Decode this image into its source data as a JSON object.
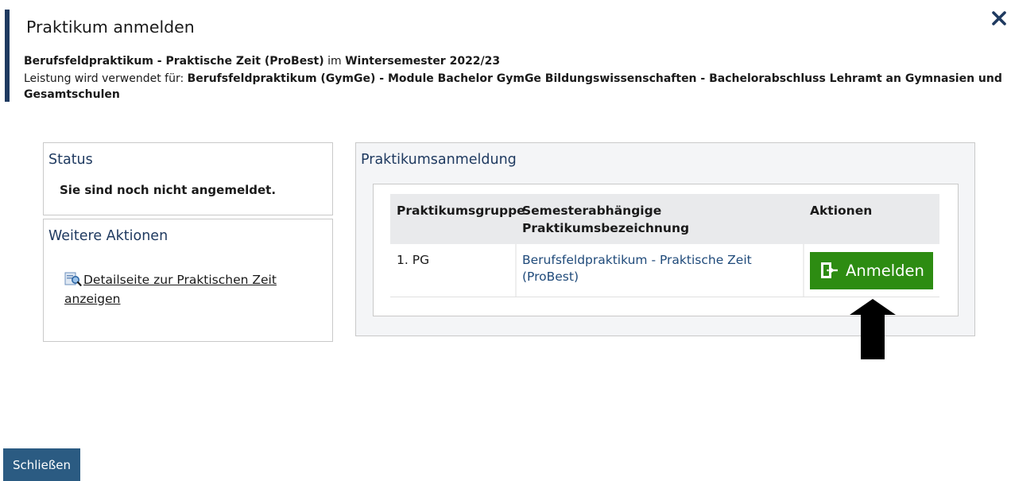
{
  "dialog": {
    "title": "Praktikum anmelden",
    "close_icon": "close-icon",
    "subtitle_bold_1": "Berufsfeldpraktikum - Praktische Zeit (ProBest)",
    "subtitle_text_1": " im ",
    "subtitle_bold_2": "Wintersemester 2022/23",
    "usage_label": "Leistung wird verwendet für: ",
    "usage_value_line1": "Berufsfeldpraktikum (GymGe) - Module Bachelor GymGe Bildungswissenschaften - Bachelorabschluss Lehramt an Gymnasien und",
    "usage_value_line2": "Gesamtschulen"
  },
  "status_panel": {
    "heading": "Status",
    "text": "Sie sind noch nicht angemeldet."
  },
  "actions_panel": {
    "heading": "Weitere Aktionen",
    "link_label": "Detailseite zur Praktischen Zeit anzeigen",
    "link_icon": "document-search-icon"
  },
  "registration_panel": {
    "heading": "Praktikumsanmeldung",
    "columns": [
      "Praktikumsgruppe",
      "Semesterabhängige Praktikumsbezeichnung",
      "Aktionen"
    ],
    "rows": [
      {
        "group": "1. PG",
        "name": "Berufsfeldpraktikum - Praktische Zeit (ProBest)",
        "action_label": "Anmelden",
        "action_icon": "door-enter-icon"
      }
    ]
  },
  "footer": {
    "close_label": "Schließen"
  },
  "colors": {
    "accent": "#1f3a60",
    "register_button": "#2d8c12",
    "close_button": "#2b5b82",
    "link": "#1f4a7a"
  }
}
